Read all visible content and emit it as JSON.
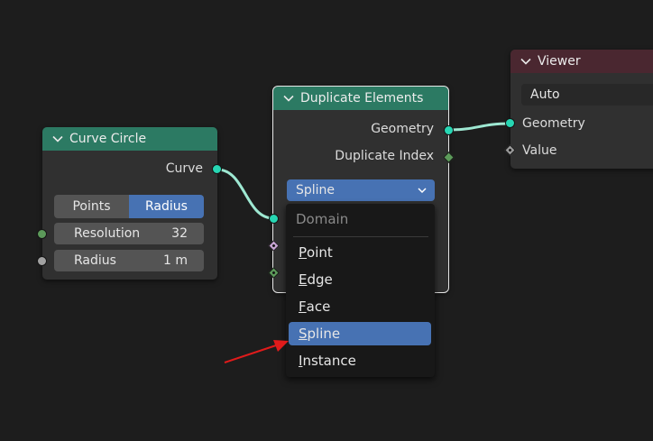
{
  "nodes": {
    "curve_circle": {
      "title": "Curve Circle",
      "output_curve": "Curve",
      "mode_points": "Points",
      "mode_radius": "Radius",
      "resolution_label": "Resolution",
      "resolution_value": "32",
      "radius_label": "Radius",
      "radius_value": "1 m"
    },
    "duplicate_elements": {
      "title": "Duplicate Elements",
      "output_geometry": "Geometry",
      "output_duplicate_index": "Duplicate Index",
      "domain_selected": "Spline"
    },
    "viewer": {
      "title": "Viewer",
      "domain_value": "Auto",
      "input_geometry": "Geometry",
      "input_value": "Value"
    }
  },
  "domain_menu": {
    "title": "Domain",
    "items": [
      {
        "key": "P",
        "rest": "oint"
      },
      {
        "key": "E",
        "rest": "dge"
      },
      {
        "key": "F",
        "rest": "ace"
      },
      {
        "key": "S",
        "rest": "pline"
      },
      {
        "key": "I",
        "rest": "nstance"
      }
    ],
    "active_item": "Spline"
  },
  "colors": {
    "geometry_socket": "#27d6b3",
    "node_header_geometry": "#2c7a63",
    "node_header_output": "#4a2730",
    "selection_accent": "#4772b3",
    "annotation_arrow": "#e01b1b"
  }
}
